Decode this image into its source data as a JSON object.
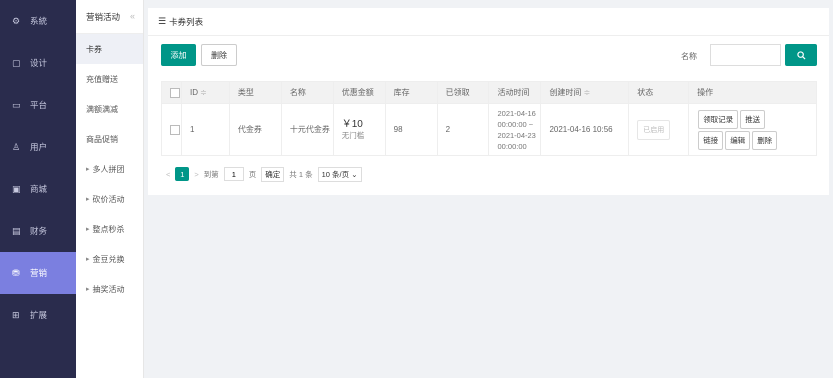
{
  "sidebar": {
    "items": [
      {
        "icon": "gear-icon",
        "glyph": "⚙",
        "label": "系統"
      },
      {
        "icon": "design-icon",
        "glyph": "▢",
        "label": "设计"
      },
      {
        "icon": "platform-icon",
        "glyph": "▭",
        "label": "平台"
      },
      {
        "icon": "user-icon",
        "glyph": "♙",
        "label": "用户"
      },
      {
        "icon": "shop-icon",
        "glyph": "▣",
        "label": "商城"
      },
      {
        "icon": "finance-icon",
        "glyph": "▤",
        "label": "财务"
      },
      {
        "icon": "marketing-icon",
        "glyph": "⛃",
        "label": "营销"
      },
      {
        "icon": "extend-icon",
        "glyph": "⊞",
        "label": "扩展"
      }
    ]
  },
  "submenu": {
    "header": "营销活动",
    "collapse_glyph": "«",
    "items": [
      "卡券",
      "充值赠送",
      "满额满减",
      "商品促销",
      "多人拼团",
      "砍价活动",
      "整点秒杀",
      "金豆兑换",
      "抽奖活动"
    ]
  },
  "panel": {
    "title_glyph": "☰",
    "title": "卡券列表"
  },
  "toolbar": {
    "add_label": "添加",
    "delete_label": "删除",
    "name_label": "名称",
    "name_placeholder": "",
    "search_glyph": "🔍"
  },
  "table": {
    "headers": [
      "ID",
      "类型",
      "名称",
      "优惠金额",
      "库存",
      "已领取",
      "活动时间",
      "创建时间",
      "状态",
      "操作"
    ],
    "sort_glyph": "≑",
    "rows": [
      {
        "id": "1",
        "type": "代金券",
        "name": "十元代金券",
        "amount": "￥10",
        "amount_note": "无门槛",
        "stock": "98",
        "claimed": "2",
        "time_start_date": "2021-04-16",
        "time_start_clock": "00:00:00 ~",
        "time_end_date": "2021-04-23",
        "time_end_clock": "00:00:00",
        "created": "2021-04-16 10:56",
        "status": "已启用",
        "ops": [
          "领取记录",
          "推送",
          "链接",
          "编辑",
          "删除"
        ]
      }
    ]
  },
  "pager": {
    "prev": "<",
    "current": "1",
    "next": ">",
    "goto_label": "到第",
    "goto_value": "1",
    "page_unit": "页",
    "confirm": "确定",
    "total": "共 1 条",
    "page_size": "10 条/页"
  },
  "colors": {
    "sidebar_bg": "#2a2c4d",
    "sidebar_active": "#7b7fe0",
    "primary": "#009688"
  }
}
